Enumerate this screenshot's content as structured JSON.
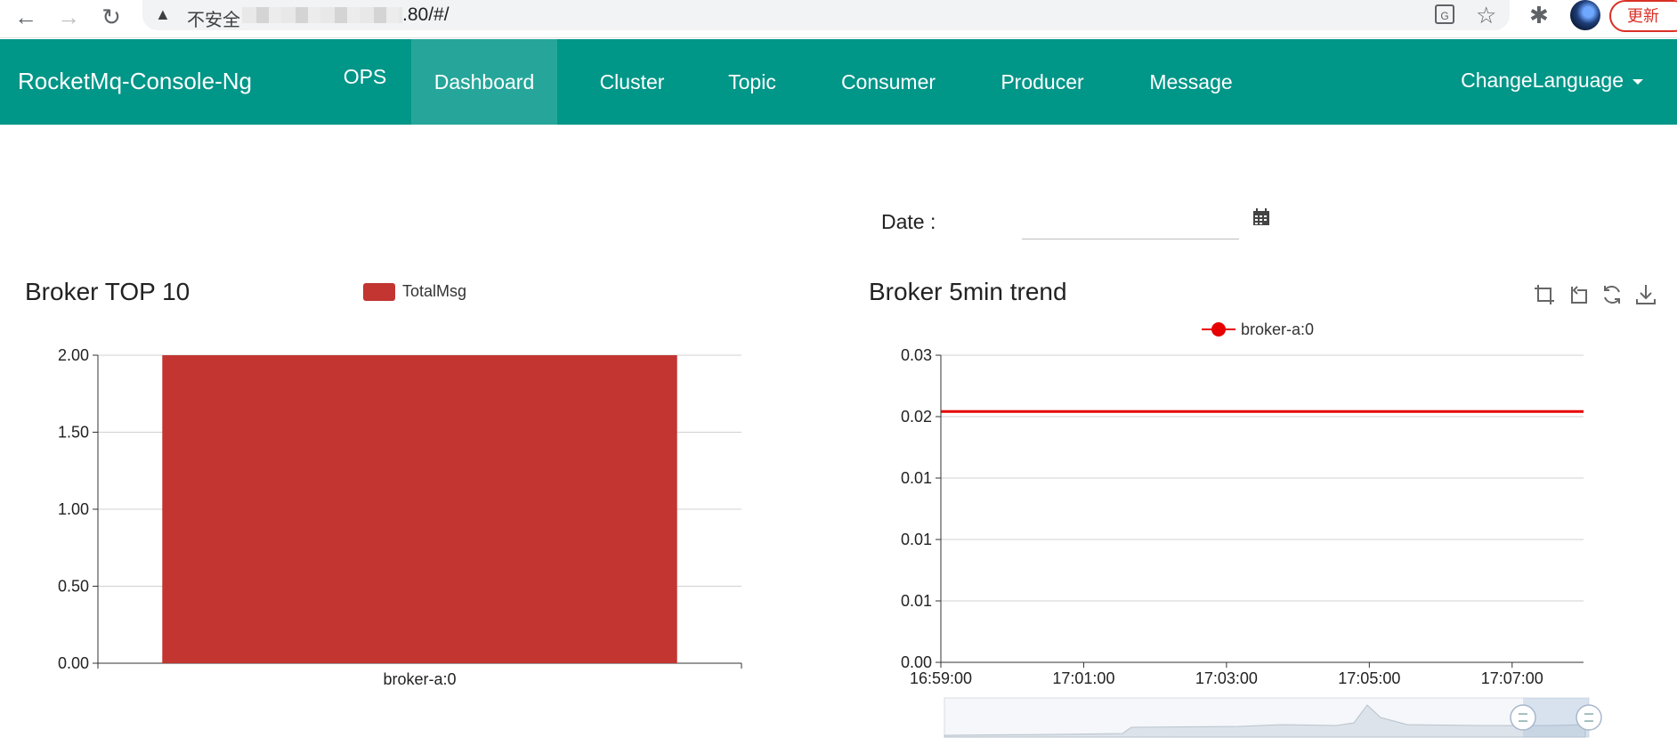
{
  "browser": {
    "security_label": "不安全",
    "url_suffix": ".80/#/",
    "update_label": "更新"
  },
  "nav": {
    "brand": "RocketMq-Console-Ng",
    "items": [
      "OPS",
      "Dashboard",
      "Cluster",
      "Topic",
      "Consumer",
      "Producer",
      "Message"
    ],
    "active": "Dashboard",
    "change_language": "ChangeLanguage"
  },
  "date_filter": {
    "label": "Date :",
    "value": ""
  },
  "colors": {
    "navbar": "#009688",
    "bar": "#c23531",
    "line": "#e60000"
  },
  "chart_data": [
    {
      "type": "bar",
      "title": "Broker TOP 10",
      "legend": [
        "TotalMsg"
      ],
      "categories": [
        "broker-a:0"
      ],
      "series": [
        {
          "name": "TotalMsg",
          "values": [
            2.0
          ]
        }
      ],
      "ylim": [
        0,
        2.0
      ],
      "yticks": [
        "0.00",
        "0.50",
        "1.00",
        "1.50",
        "2.00"
      ],
      "grid": true,
      "legend_position": "top"
    },
    {
      "type": "line",
      "title": "Broker 5min trend",
      "legend": [
        "broker-a:0"
      ],
      "x": [
        "16:59:00",
        "17:01:00",
        "17:03:00",
        "17:05:00",
        "17:07:00"
      ],
      "series": [
        {
          "name": "broker-a:0",
          "values": [
            0.0245,
            0.0245,
            0.0245,
            0.0245,
            0.0245
          ]
        }
      ],
      "ylim": [
        0,
        0.03
      ],
      "yticks": [
        "0.00",
        "0.01",
        "0.01",
        "0.01",
        "0.02",
        "0.03"
      ],
      "grid": true,
      "legend_position": "top",
      "toolbox": [
        "zoom-icon",
        "zoom-reset-icon",
        "restore-icon",
        "save-image-icon"
      ],
      "data_zoom": {
        "start": 0,
        "end": 100
      }
    }
  ]
}
